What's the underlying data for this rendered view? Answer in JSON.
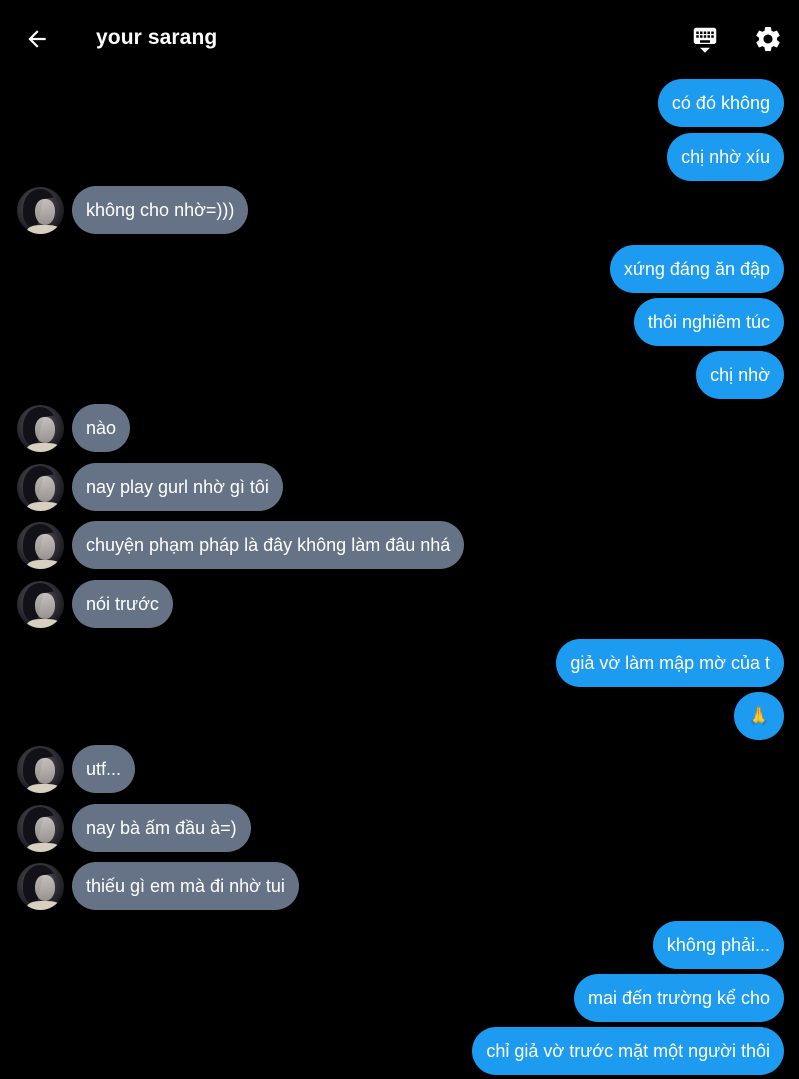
{
  "header": {
    "title": "your sarang",
    "back_icon": "arrow-left-icon",
    "keyboard_icon": "keyboard-icon",
    "settings_icon": "gear-icon"
  },
  "colors": {
    "background": "#000000",
    "sent_bubble": "#1d9bf0",
    "received_bubble": "#667386",
    "text": "#ffffff"
  },
  "messages": [
    {
      "side": "sent",
      "text": "có đó không"
    },
    {
      "side": "sent",
      "text": "chị nhờ xíu"
    },
    {
      "side": "received",
      "text": "không cho nhờ=)))"
    },
    {
      "side": "sent",
      "text": "xứng đáng ăn đập"
    },
    {
      "side": "sent",
      "text": "thôi nghiêm túc"
    },
    {
      "side": "sent",
      "text": "chị nhờ"
    },
    {
      "side": "received",
      "text": "nào"
    },
    {
      "side": "received",
      "text": "nay play gurl nhờ gì tôi"
    },
    {
      "side": "received",
      "text": "chuyện phạm pháp là đây không làm đâu nhá"
    },
    {
      "side": "received",
      "text": "nói trước"
    },
    {
      "side": "sent",
      "text": "giả vờ làm mập mờ của t"
    },
    {
      "side": "sent",
      "text": "🙏"
    },
    {
      "side": "received",
      "text": "utf..."
    },
    {
      "side": "received",
      "text": "nay bà ấm đầu à=)"
    },
    {
      "side": "received",
      "text": "thiếu gì em mà đi nhờ tui"
    },
    {
      "side": "sent",
      "text": "không phải..."
    },
    {
      "side": "sent",
      "text": "mai đến trường kể cho"
    },
    {
      "side": "sent",
      "text": "chỉ giả vờ trước mặt một người thôi"
    }
  ]
}
